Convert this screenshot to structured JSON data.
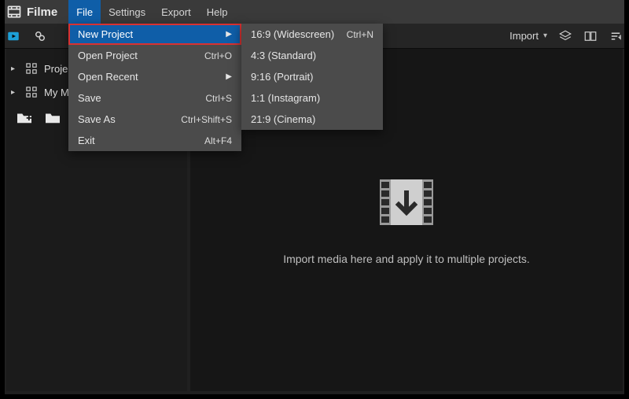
{
  "app": {
    "name": "Filme"
  },
  "menubar": {
    "file": "File",
    "settings": "Settings",
    "export": "Export",
    "help": "Help"
  },
  "file_menu": {
    "new_project": "New Project",
    "open_project": {
      "label": "Open Project",
      "shortcut": "Ctrl+O"
    },
    "open_recent": "Open Recent",
    "save": {
      "label": "Save",
      "shortcut": "Ctrl+S"
    },
    "save_as": {
      "label": "Save As",
      "shortcut": "Ctrl+Shift+S"
    },
    "exit": {
      "label": "Exit",
      "shortcut": "Alt+F4"
    }
  },
  "new_project_submenu": {
    "r16_9": {
      "label": "16:9 (Widescreen)",
      "shortcut": "Ctrl+N"
    },
    "r4_3": {
      "label": "4:3 (Standard)"
    },
    "r9_16": {
      "label": "9:16 (Portrait)"
    },
    "r1_1": {
      "label": "1:1 (Instagram)"
    },
    "r21_9": {
      "label": "21:9 (Cinema)"
    }
  },
  "toolbar": {
    "import": "Import"
  },
  "sidebar": {
    "item1": "Project Media",
    "item2": "My Media"
  },
  "main": {
    "drop_text": "Import media here and apply it to multiple projects."
  }
}
